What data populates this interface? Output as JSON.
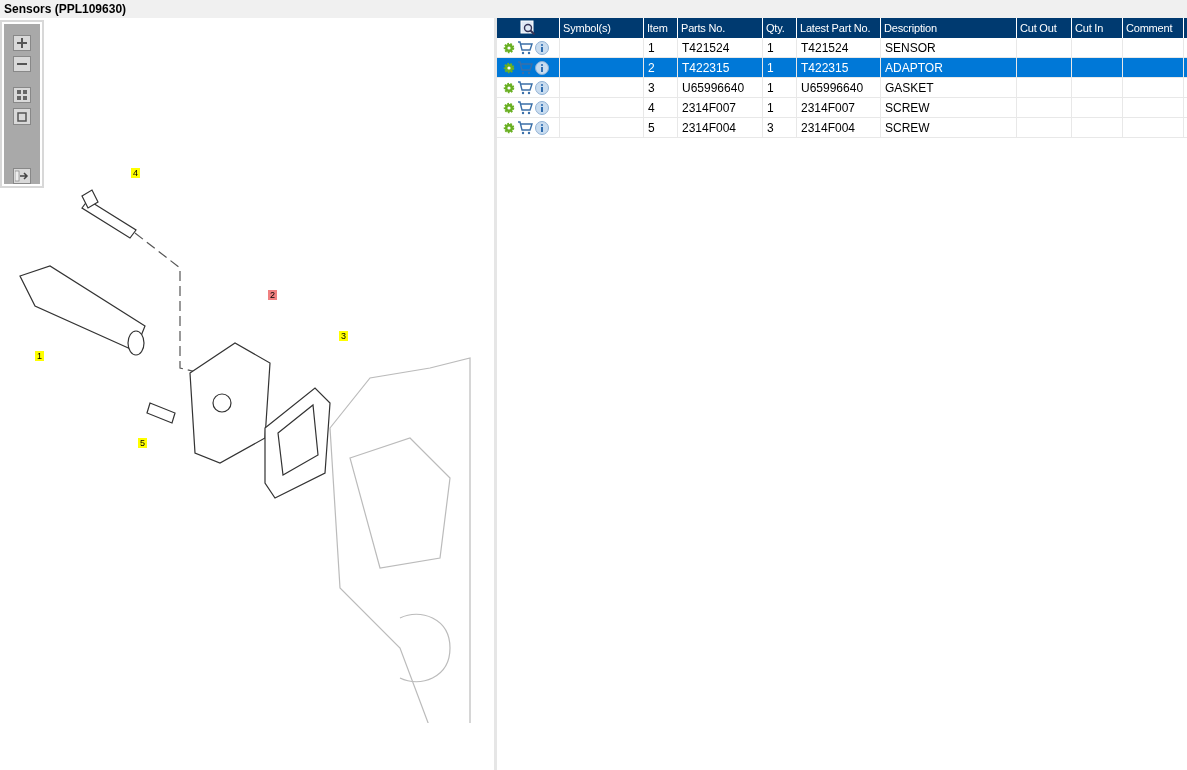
{
  "title": "Sensors (PPL109630)",
  "callouts": [
    {
      "label": "4",
      "selected": false
    },
    {
      "label": "1",
      "selected": false
    },
    {
      "label": "2",
      "selected": true
    },
    {
      "label": "3",
      "selected": false
    },
    {
      "label": "5",
      "selected": false
    }
  ],
  "table": {
    "columns": [
      "Symbol(s)",
      "Item",
      "Parts No.",
      "Qty.",
      "Latest Part No.",
      "Description",
      "Cut Out",
      "Cut In",
      "Comment"
    ],
    "rows": [
      {
        "selected": false,
        "cells": [
          "",
          "1",
          "T421524",
          "1",
          "T421524",
          "SENSOR",
          "",
          "",
          ""
        ]
      },
      {
        "selected": true,
        "cells": [
          "",
          "2",
          "T422315",
          "1",
          "T422315",
          "ADAPTOR",
          "",
          "",
          ""
        ]
      },
      {
        "selected": false,
        "cells": [
          "",
          "3",
          "U65996640",
          "1",
          "U65996640",
          "GASKET",
          "",
          "",
          ""
        ]
      },
      {
        "selected": false,
        "cells": [
          "",
          "4",
          "2314F007",
          "1",
          "2314F007",
          "SCREW",
          "",
          "",
          ""
        ]
      },
      {
        "selected": false,
        "cells": [
          "",
          "5",
          "2314F004",
          "3",
          "2314F004",
          "SCREW",
          "",
          "",
          ""
        ]
      }
    ]
  }
}
